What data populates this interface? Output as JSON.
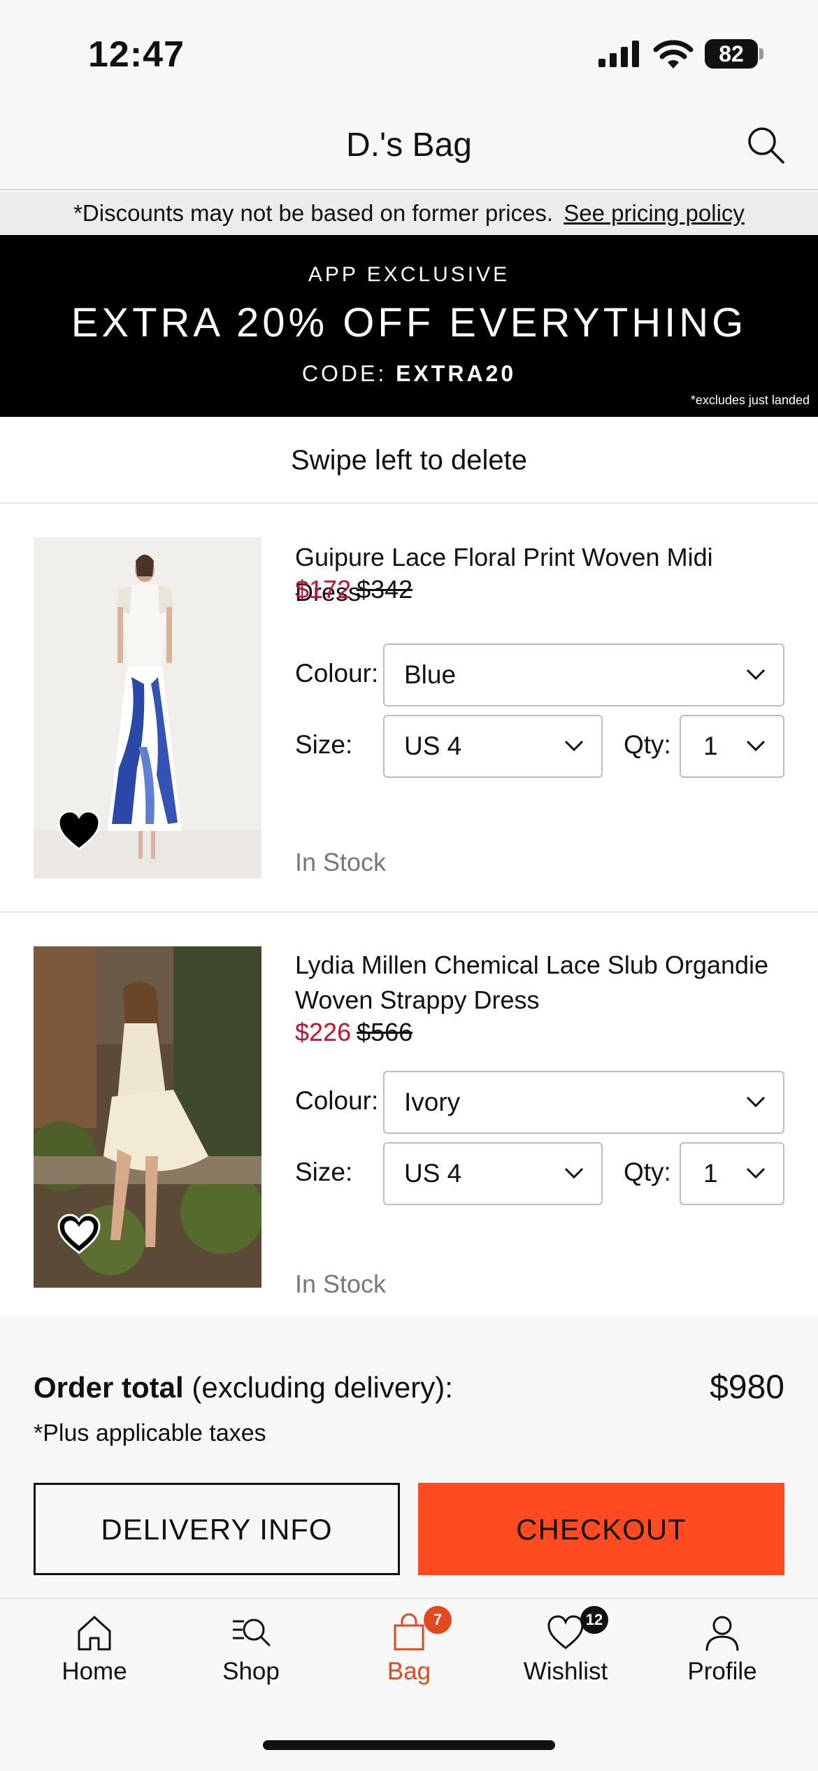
{
  "status_bar": {
    "time": "12:47",
    "battery": "82"
  },
  "header": {
    "title": "D.'s Bag"
  },
  "disclaimer": {
    "text": "*Discounts may not be based on former prices.",
    "link": "See pricing policy"
  },
  "promo": {
    "eyebrow": "APP EXCLUSIVE",
    "headline": "EXTRA 20% OFF EVERYTHING",
    "code_label": "CODE:",
    "code": "EXTRA20",
    "note": "*excludes just landed"
  },
  "swipe_hint": "Swipe left to delete",
  "items": [
    {
      "name": "Guipure Lace Floral Print Woven Midi Dress",
      "price_now": "$172",
      "price_was": "$342",
      "colour_label": "Colour:",
      "colour": "Blue",
      "size_label": "Size:",
      "size": "US 4",
      "qty_label": "Qty:",
      "qty": "1",
      "stock": "In Stock",
      "wishlisted": true
    },
    {
      "name": "Lydia Millen Chemical Lace Slub Organdie Woven Strappy Dress",
      "price_now": "$226",
      "price_was": "$566",
      "colour_label": "Colour:",
      "colour": "Ivory",
      "size_label": "Size:",
      "size": "US 4",
      "qty_label": "Qty:",
      "qty": "1",
      "stock": "In Stock",
      "wishlisted": false
    }
  ],
  "summary": {
    "total_label_bold": "Order total",
    "total_label_rest": "(excluding delivery):",
    "total": "$980",
    "tax_note": "*Plus applicable taxes",
    "delivery_button": "DELIVERY INFO",
    "checkout_button": "CHECKOUT"
  },
  "tabbar": {
    "tabs": [
      {
        "label": "Home",
        "icon": "home-icon"
      },
      {
        "label": "Shop",
        "icon": "shop-search-icon"
      },
      {
        "label": "Bag",
        "icon": "bag-icon",
        "badge": "7",
        "active": true
      },
      {
        "label": "Wishlist",
        "icon": "heart-icon",
        "badge": "12"
      },
      {
        "label": "Profile",
        "icon": "profile-icon"
      }
    ]
  },
  "colors": {
    "accent": "#ff4b1f",
    "sale": "#c8102e",
    "bag_badge": "#e14a1f",
    "wishlist_badge": "#111111"
  }
}
